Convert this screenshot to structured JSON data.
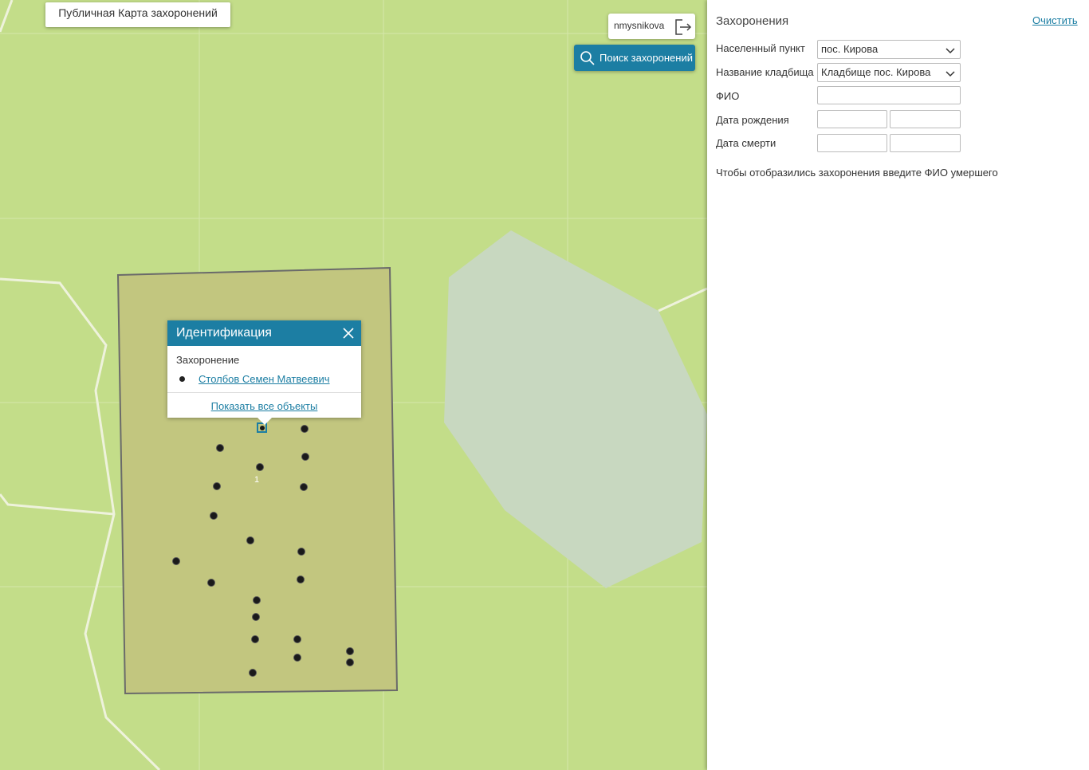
{
  "app": {
    "title": "Публичная Карта захоронений"
  },
  "header": {
    "username": "nmysnikova",
    "search_button": "Поиск захоронений"
  },
  "popup": {
    "title": "Идентификация",
    "category": "Захоронение",
    "item": "Столбов Семен Матвеевич",
    "show_all": "Показать все объекты"
  },
  "map": {
    "cluster_label": "1",
    "colors": {
      "background": "#c3dd89",
      "cemetery_fill": "#c2c67f",
      "gray_area": "#c8d8c0",
      "accent": "#1c7ea3"
    }
  },
  "panel": {
    "title": "Захоронения",
    "clear": "Очистить",
    "fields": {
      "settlement_label": "Населенный пункт",
      "settlement_value": "пос. Кирова",
      "cemetery_label": "Название кладбища",
      "cemetery_value": "Кладбище пос. Кирова",
      "name_label": "ФИО",
      "name_value": "",
      "birth_label": "Дата рождения",
      "birth_from": "",
      "birth_to": "",
      "death_label": "Дата смерти",
      "death_from": "",
      "death_to": ""
    },
    "hint": "Чтобы отобразились захоронения введите ФИО умершего"
  }
}
